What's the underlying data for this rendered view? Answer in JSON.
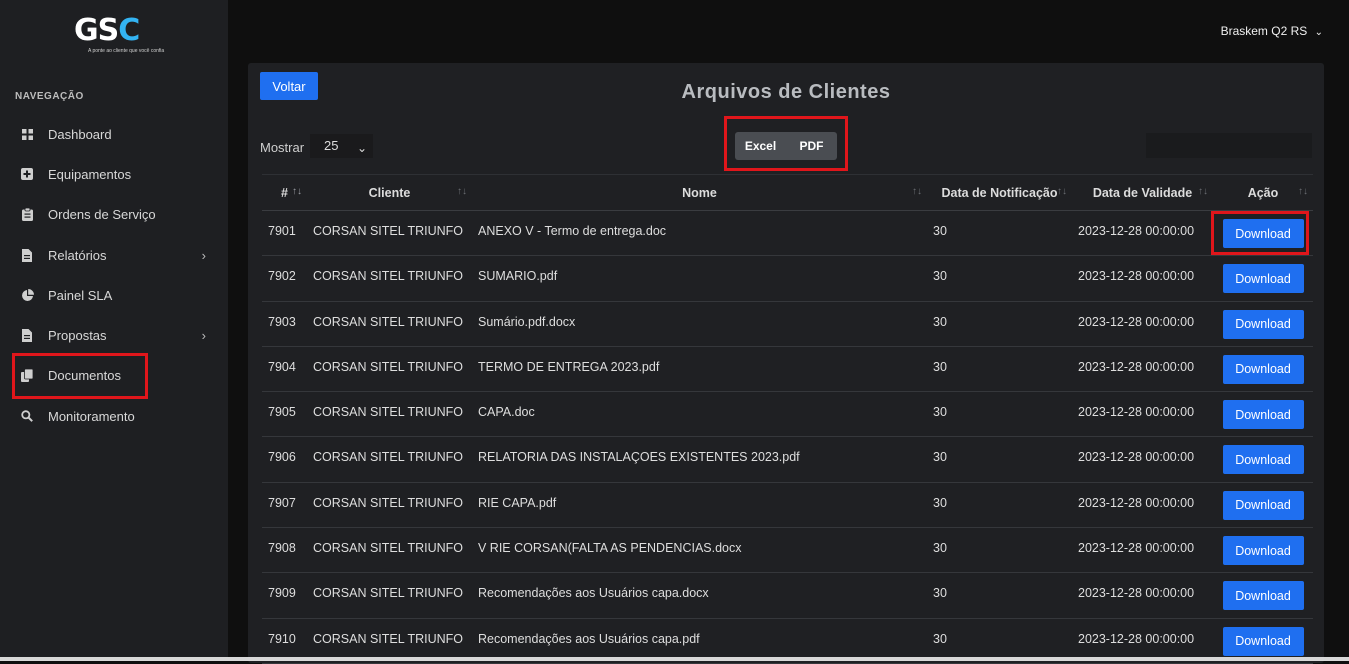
{
  "brand": {
    "logo_main": "GS",
    "logo_accent": "C",
    "logo_tagline": "A ponte ao cliente que você confia"
  },
  "sidebar": {
    "section_title": "NAVEGAÇÃO",
    "items": [
      {
        "label": "Dashboard",
        "icon": "dashboard-icon"
      },
      {
        "label": "Equipamentos",
        "icon": "plus-square-icon"
      },
      {
        "label": "Ordens de Serviço",
        "icon": "clipboard-icon"
      },
      {
        "label": "Relatórios",
        "icon": "file-icon",
        "chevron": true
      },
      {
        "label": "Painel SLA",
        "icon": "pie-chart-icon"
      },
      {
        "label": "Propostas",
        "icon": "file-icon",
        "chevron": true
      },
      {
        "label": "Documentos",
        "icon": "copy-icon"
      },
      {
        "label": "Monitoramento",
        "icon": "search-icon"
      }
    ]
  },
  "topbar": {
    "user": "Braskem Q2 RS"
  },
  "main": {
    "back_label": "Voltar",
    "title": "Arquivos de Clientes",
    "show_label": "Mostrar",
    "show_value": "25",
    "export_excel": "Excel",
    "export_pdf": "PDF",
    "search_placeholder": ""
  },
  "table": {
    "columns": [
      "#",
      "Cliente",
      "Nome",
      "Data de Notificação",
      "Data de Validade",
      "Ação"
    ],
    "download_label": "Download",
    "rows": [
      {
        "id": "7901",
        "cliente": "CORSAN SITEL TRIUNFO",
        "nome": "ANEXO V - Termo de entrega.doc",
        "notificacao": "30",
        "validade": "2023-12-28 00:00:00"
      },
      {
        "id": "7902",
        "cliente": "CORSAN SITEL TRIUNFO",
        "nome": "SUMARIO.pdf",
        "notificacao": "30",
        "validade": "2023-12-28 00:00:00"
      },
      {
        "id": "7903",
        "cliente": "CORSAN SITEL TRIUNFO",
        "nome": "Sumário.pdf.docx",
        "notificacao": "30",
        "validade": "2023-12-28 00:00:00"
      },
      {
        "id": "7904",
        "cliente": "CORSAN SITEL TRIUNFO",
        "nome": "TERMO DE ENTREGA 2023.pdf",
        "notificacao": "30",
        "validade": "2023-12-28 00:00:00"
      },
      {
        "id": "7905",
        "cliente": "CORSAN SITEL TRIUNFO",
        "nome": "CAPA.doc",
        "notificacao": "30",
        "validade": "2023-12-28 00:00:00"
      },
      {
        "id": "7906",
        "cliente": "CORSAN SITEL TRIUNFO",
        "nome": "RELATORIA DAS INSTALAÇOES EXISTENTES 2023.pdf",
        "notificacao": "30",
        "validade": "2023-12-28 00:00:00"
      },
      {
        "id": "7907",
        "cliente": "CORSAN SITEL TRIUNFO",
        "nome": "RIE CAPA.pdf",
        "notificacao": "30",
        "validade": "2023-12-28 00:00:00"
      },
      {
        "id": "7908",
        "cliente": "CORSAN SITEL TRIUNFO",
        "nome": "V RIE CORSAN(FALTA AS PENDENCIAS.docx",
        "notificacao": "30",
        "validade": "2023-12-28 00:00:00"
      },
      {
        "id": "7909",
        "cliente": "CORSAN SITEL TRIUNFO",
        "nome": "Recomendações aos Usuários capa.docx",
        "notificacao": "30",
        "validade": "2023-12-28 00:00:00"
      },
      {
        "id": "7910",
        "cliente": "CORSAN SITEL TRIUNFO",
        "nome": "Recomendações aos Usuários capa.pdf",
        "notificacao": "30",
        "validade": "2023-12-28 00:00:00"
      }
    ]
  },
  "colors": {
    "accent": "#1f6ff0",
    "highlight": "#e0161b",
    "sidebar_bg": "#1e1f22",
    "card_bg": "#1f2023"
  }
}
